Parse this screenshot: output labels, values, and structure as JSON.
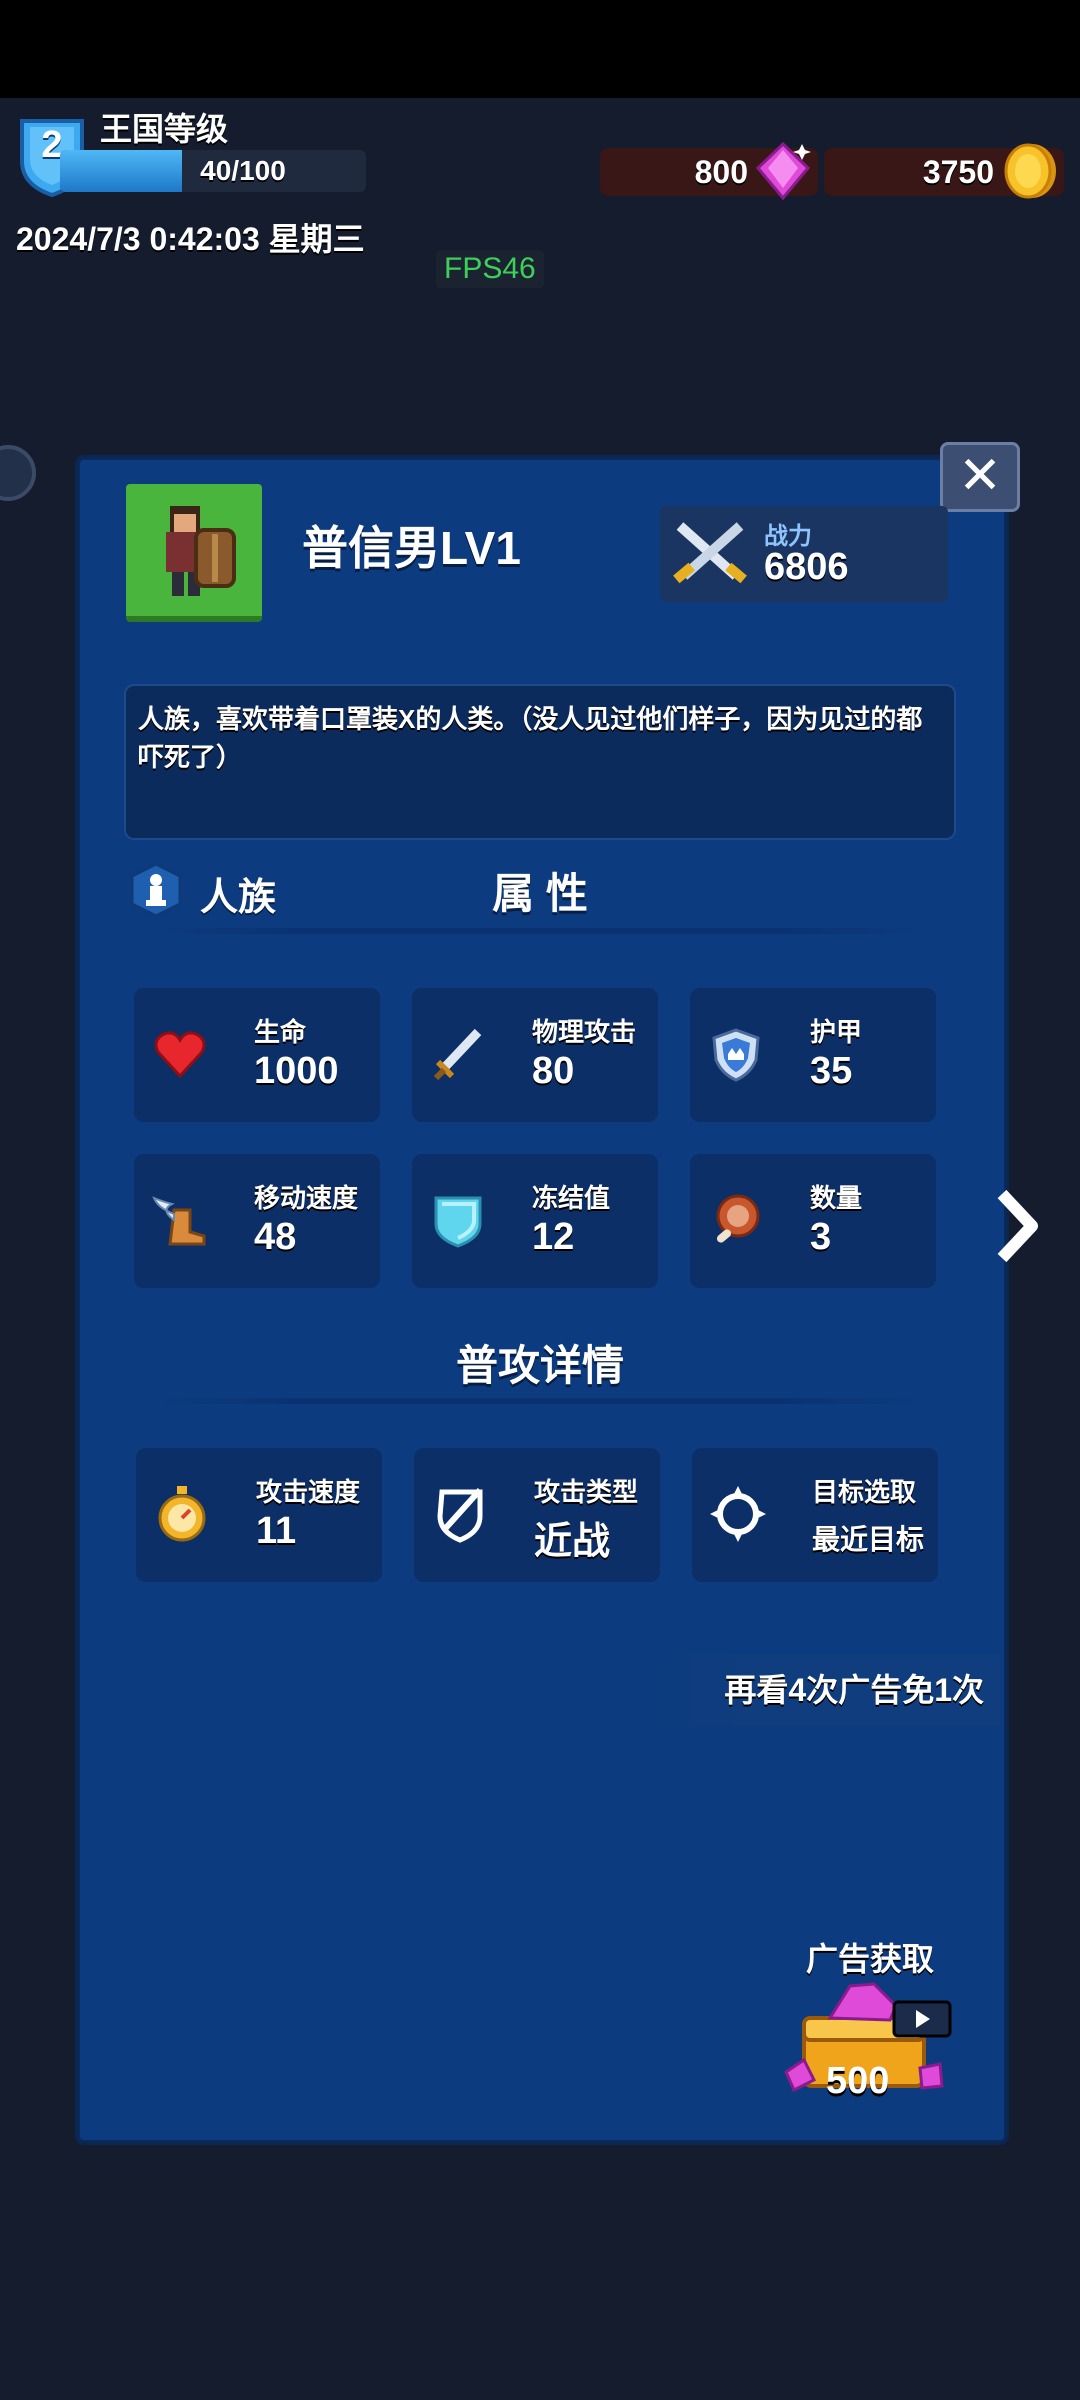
{
  "header": {
    "level_number": "2",
    "level_title": "王国等级",
    "xp_text": "40/100",
    "xp_progress": 0.4,
    "gems": "800",
    "coins": "3750",
    "datetime": "2024/7/3 0:42:03 星期三",
    "fps": "FPS46"
  },
  "unit": {
    "name": "普信男LV1",
    "power_label": "战力",
    "power_value": "6806",
    "description": "人族，喜欢带着口罩装X的人类。（没人见过他们样子，因为见过的都吓死了）",
    "race": "人族"
  },
  "attributes": {
    "title": "属 性",
    "items": [
      {
        "label": "生命",
        "value": "1000",
        "icon": "heart-icon"
      },
      {
        "label": "物理攻击",
        "value": "80",
        "icon": "sword-icon"
      },
      {
        "label": "护甲",
        "value": "35",
        "icon": "armor-shield-icon"
      },
      {
        "label": "移动速度",
        "value": "48",
        "icon": "winged-boot-icon"
      },
      {
        "label": "冻结值",
        "value": "12",
        "icon": "ice-shield-icon"
      },
      {
        "label": "数量",
        "value": "3",
        "icon": "meat-icon"
      }
    ]
  },
  "basic_attack": {
    "title": "普攻详情",
    "items": [
      {
        "label": "攻击速度",
        "value": "11",
        "icon": "stopwatch-icon"
      },
      {
        "label": "攻击类型",
        "value": "近战",
        "icon": "melee-shield-icon"
      },
      {
        "label": "目标选取",
        "value": "最近目标",
        "icon": "target-icon"
      }
    ]
  },
  "ad": {
    "strip_text": "再看4次广告免1次",
    "title": "广告获取",
    "amount": "500"
  },
  "colors": {
    "panel": "#0c3b7f",
    "xp_fill": "#2a95e3",
    "fps_text": "#3ecf5a",
    "portrait_bg": "#4ab53c"
  }
}
